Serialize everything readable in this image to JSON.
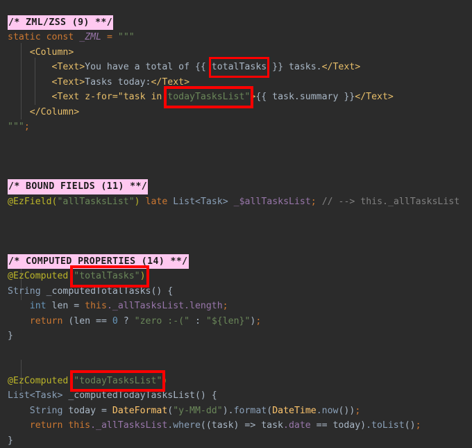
{
  "editor": {
    "background": "#2b2b2b",
    "default_text_color": "#a9b7c6",
    "highlight_box_color": "#ff0000",
    "banner_background": "#ffc8f0",
    "language": "dart"
  },
  "sections": [
    {
      "banner": "/* ZML/ZSS (9) **/",
      "count_label": "(9)",
      "title": "ZML/ZSS"
    },
    {
      "banner": "/* BOUND FIELDS (11) **/",
      "count_label": "(11)",
      "title": "BOUND FIELDS"
    },
    {
      "banner": "/* COMPUTED PROPERTIES (14) **/",
      "count_label": "(14)",
      "title": "COMPUTED PROPERTIES"
    }
  ],
  "code": {
    "zml_decl": {
      "keyword_static": "static",
      "keyword_const": "const",
      "name": "_ZML",
      "equals": "=",
      "triple_quote_open": "\"\"\"",
      "triple_quote_close": "\"\"\"",
      "semicolon": ";"
    },
    "zml_markup": {
      "column_open": "<Column>",
      "column_close": "</Column>",
      "text_open": "<Text>",
      "text_close": "</Text>",
      "line1_text": "You have a total of {{ ",
      "line1_binding": "totalTasks",
      "line1_tail": " }} tasks.",
      "line2_text": "Tasks today:",
      "line3_tag_open": "<Text z-for=\"task in ",
      "line3_binding": "todayTasksList",
      "line3_quote": "\"",
      "line3_gt": ">",
      "line3_body": "{{ task.summary }}"
    },
    "bound_field": {
      "annotation": "@EzField",
      "paren_open": "(",
      "arg_string": "\"allTasksList\"",
      "paren_close": ")",
      "keyword_late": "late",
      "type": "List<Task>",
      "field_name": "_$allTasksList",
      "semicolon": ";",
      "trailing_comment": "// --> this._allTasksList"
    },
    "computed_total": {
      "annotation": "@EzComputed",
      "paren_open": "(",
      "arg_string": "\"totalTasks\"",
      "paren_close": ")",
      "return_type": "String",
      "method_name": "_computedTotalTasks() {",
      "body_line1_type": "int",
      "body_line1_rest": " len = ",
      "body_line1_this": "this",
      "body_line1_field": "._allTasksList.length",
      "body_line1_semi": ";",
      "body_line2_return": "return",
      "body_line2_expr_a": " (len == ",
      "body_line2_zero": "0",
      "body_line2_expr_b": " ? ",
      "body_line2_str1": "\"zero :-(\"",
      "body_line2_expr_c": " : ",
      "body_line2_str2": "\"${len}\"",
      "body_line2_expr_d": ")",
      "body_line2_semi": ";",
      "closing_brace": "}"
    },
    "computed_today": {
      "annotation": "@EzComputed",
      "paren_open": "(",
      "arg_string": "\"todayTasksList\"",
      "paren_close": ")",
      "return_type": "List<Task>",
      "method_name": "_computedTodayTasksList() {",
      "body_line1_type": "String",
      "body_line1_var": " today = ",
      "body_line1_fn": "DateFormat",
      "body_line1_paren": "(",
      "body_line1_str": "\"y-MM-dd\"",
      "body_line1_mid": ").",
      "body_line1_format": "format",
      "body_line1_paren2": "(",
      "body_line1_datetime": "DateTime",
      "body_line1_now": ".now",
      "body_line1_tail": "())",
      "body_line1_semi": ";",
      "body_line2_return": "return",
      "body_line2_this": " this",
      "body_line2_field": "._allTasksList",
      "body_line2_where": ".where",
      "body_line2_args": "((task) => task",
      "body_line2_date": ".date",
      "body_line2_cmp": " == today)",
      "body_line2_tolist": ".toList",
      "body_line2_tail": "()",
      "body_line2_semi": ";",
      "closing_brace": "}"
    }
  },
  "highlights": [
    {
      "name": "totalTasks-binding-box",
      "token": "totalTasks"
    },
    {
      "name": "todayTasksList-binding-box",
      "token": "todayTasksList"
    },
    {
      "name": "totalTasks-computed-name-box",
      "token": "\"totalTasks\""
    },
    {
      "name": "todayTasksList-computed-name-box",
      "token": "\"todayTasksList\""
    }
  ]
}
